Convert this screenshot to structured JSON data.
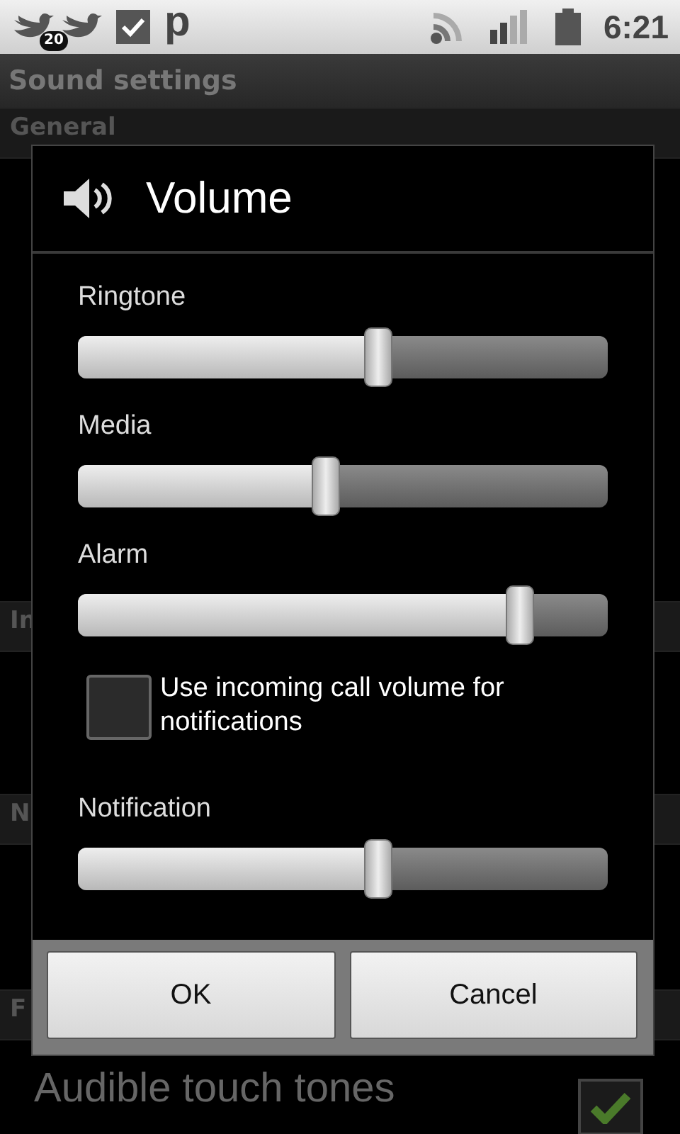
{
  "status_bar": {
    "notification_count": "20",
    "app_letter": "p",
    "time": "6:21"
  },
  "app_bar": {
    "title": "Sound settings"
  },
  "background": [
    {
      "kind": "header",
      "label": "General"
    },
    {
      "kind": "header",
      "label": "In"
    },
    {
      "kind": "header",
      "label": "N"
    },
    {
      "kind": "header",
      "label": "F"
    },
    {
      "kind": "checkrow",
      "label": "Audible touch tones",
      "checked": true
    }
  ],
  "dialog": {
    "title": "Volume",
    "items": [
      {
        "kind": "slider",
        "label": "Ringtone",
        "level": 0.567
      },
      {
        "kind": "slider",
        "label": "Media",
        "level": 0.468
      },
      {
        "kind": "slider",
        "label": "Alarm",
        "level": 0.834
      },
      {
        "kind": "checkbox",
        "label": "Use incoming call volume for notifications",
        "checked": false
      },
      {
        "kind": "slider",
        "label": "Notification",
        "level": 0.567
      }
    ],
    "buttons": [
      "OK",
      "Cancel"
    ]
  }
}
